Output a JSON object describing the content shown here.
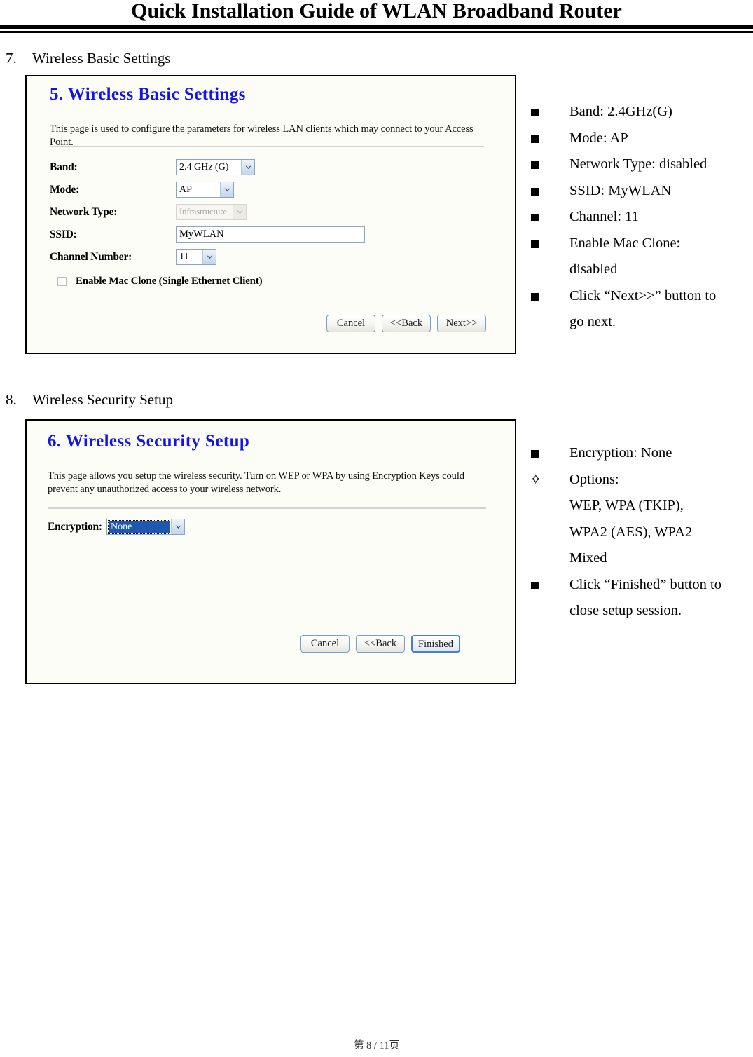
{
  "header": {
    "title": "Quick Installation Guide of WLAN Broadband Router"
  },
  "sections": [
    {
      "number": "7.",
      "heading": "Wireless Basic Settings",
      "panel": {
        "title": "5. Wireless Basic Settings",
        "description": "This page is used to configure the parameters for wireless LAN clients which may connect to your Access Point.",
        "fields": [
          {
            "label": "Band:",
            "type": "select",
            "value": "2.4 GHz (G)",
            "state": "enabled"
          },
          {
            "label": "Mode:",
            "type": "select",
            "value": "AP",
            "state": "enabled"
          },
          {
            "label": "Network Type:",
            "type": "select",
            "value": "Infrastructure",
            "state": "disabled"
          },
          {
            "label": "SSID:",
            "type": "text",
            "value": "MyWLAN",
            "state": "enabled"
          },
          {
            "label": "Channel Number:",
            "type": "select",
            "value": "11",
            "state": "enabled"
          }
        ],
        "checkbox": {
          "label": "Enable Mac Clone (Single Ethernet Client)",
          "checked": false
        },
        "buttons": [
          {
            "label": "Cancel",
            "state": "normal"
          },
          {
            "label": "<<Back",
            "state": "normal"
          },
          {
            "label": "Next>>",
            "state": "normal"
          }
        ]
      },
      "notes": [
        {
          "marker": "square",
          "text": "Band: 2.4GHz(G)"
        },
        {
          "marker": "square",
          "text": "Mode: AP"
        },
        {
          "marker": "square",
          "text": "Network Type: disabled"
        },
        {
          "marker": "square",
          "text": "SSID: MyWLAN"
        },
        {
          "marker": "square",
          "text": "Channel: 11"
        },
        {
          "marker": "square",
          "text": "Enable Mac Clone:",
          "continuation": "disabled"
        },
        {
          "marker": "square",
          "text": "Click “Next>>” button to",
          "continuation": "go next."
        }
      ]
    },
    {
      "number": "8.",
      "heading": "Wireless Security Setup",
      "panel": {
        "title": "6. Wireless Security Setup",
        "description": "This page allows you setup the wireless security. Turn on WEP or WPA by using Encryption Keys could prevent any unauthorized access to your wireless network.",
        "fields": [
          {
            "label": "Encryption:",
            "type": "select",
            "value": "None",
            "state": "focused"
          }
        ],
        "buttons": [
          {
            "label": "Cancel",
            "state": "normal"
          },
          {
            "label": "<<Back",
            "state": "normal"
          },
          {
            "label": "Finished",
            "state": "focused"
          }
        ]
      },
      "notes": [
        {
          "marker": "square",
          "text": "Encryption: None"
        },
        {
          "marker": "diamond",
          "text": "Options:",
          "continuation": "WEP, WPA (TKIP),",
          "continuation2": "WPA2 (AES), WPA2",
          "continuation3": "Mixed"
        },
        {
          "marker": "square",
          "text": "Click “Finished” button to",
          "continuation": "close setup session."
        }
      ]
    }
  ],
  "footer": {
    "page_label": "第 8 / 11页"
  }
}
